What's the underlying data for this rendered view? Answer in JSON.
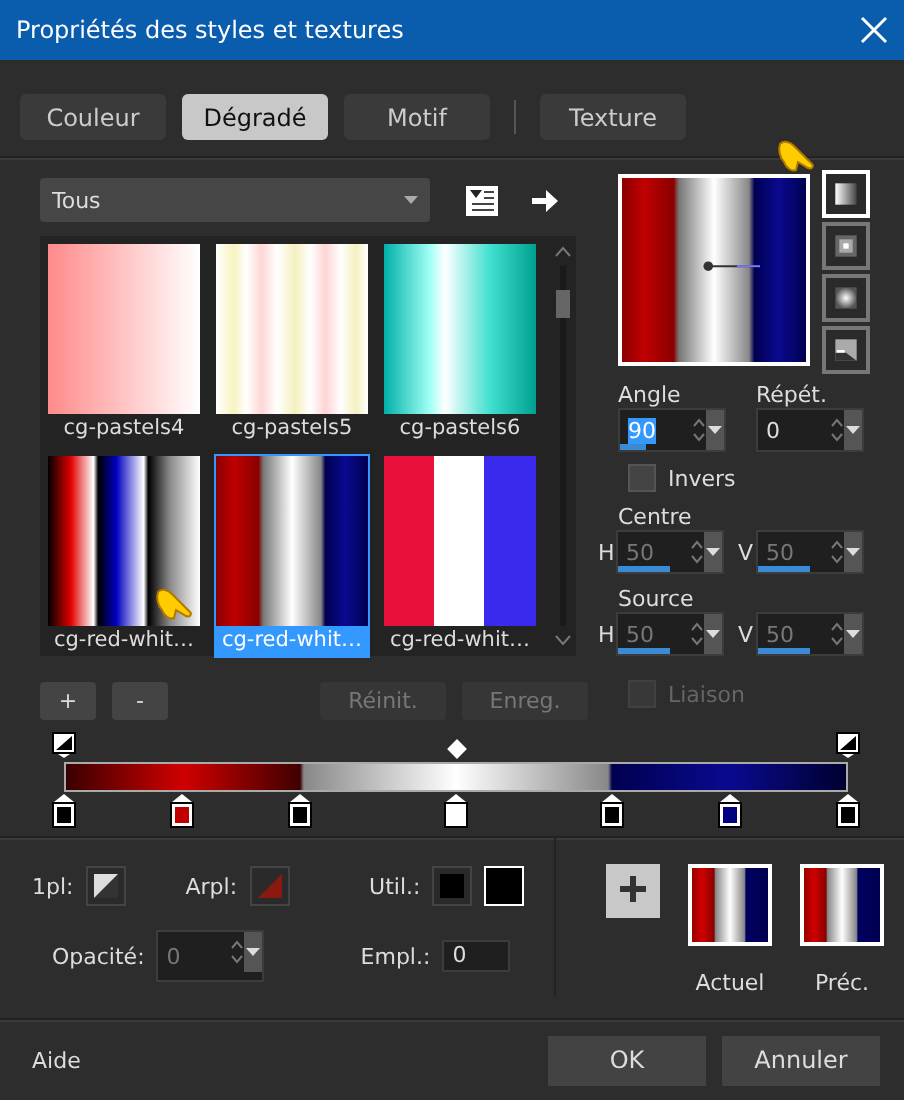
{
  "window": {
    "title": "Propriétés des styles et textures"
  },
  "tabs": [
    {
      "label": "Couleur",
      "selected": false
    },
    {
      "label": "Dégradé",
      "selected": true
    },
    {
      "label": "Motif",
      "selected": false
    },
    {
      "label": "Texture",
      "selected": false
    }
  ],
  "category": {
    "value": "Tous"
  },
  "gallery": [
    {
      "label": "cg-pastels4",
      "selected": false
    },
    {
      "label": "cg-pastels5",
      "selected": false
    },
    {
      "label": "cg-pastels6",
      "selected": false
    },
    {
      "label": "cg-red-whit…",
      "selected": false
    },
    {
      "label": "cg-red-whit…",
      "selected": true
    },
    {
      "label": "cg-red-whit…",
      "selected": false
    }
  ],
  "gallery_buttons": [
    {
      "label": "+",
      "disabled": false
    },
    {
      "label": "-",
      "disabled": false
    },
    {
      "label": "Réinit.",
      "disabled": true
    },
    {
      "label": "Enreg.",
      "disabled": true
    }
  ],
  "styles": [
    {
      "kind": "linear",
      "selected": true
    },
    {
      "kind": "rectangular",
      "selected": false
    },
    {
      "kind": "sunburst",
      "selected": false
    },
    {
      "kind": "radial",
      "selected": false
    }
  ],
  "angle": {
    "label": "Angle",
    "value": "90",
    "level": 0.25,
    "text_selected": true
  },
  "repeat": {
    "label": "Répét.",
    "value": "0",
    "text_selected": false
  },
  "invert": {
    "label": "Invers",
    "checked": false,
    "disabled": false
  },
  "center": {
    "label": "Centre",
    "h_label": "H",
    "h": {
      "value": "50",
      "level": 0.5,
      "disabled": true
    },
    "v_label": "V",
    "v": {
      "value": "50",
      "level": 0.5,
      "disabled": true
    }
  },
  "source": {
    "label": "Source",
    "h_label": "H",
    "h": {
      "value": "50",
      "level": 0.5,
      "disabled": true
    },
    "v_label": "V",
    "v": {
      "value": "50",
      "level": 0.5,
      "disabled": true
    }
  },
  "link": {
    "label": "Liaison",
    "checked": false,
    "disabled": true
  },
  "opacity_stops": [
    {
      "color": "#000000"
    },
    {
      "color": "#000000"
    }
  ],
  "color_stops": [
    {
      "color": "#000000"
    },
    {
      "color": "#c00000"
    },
    {
      "color": "#000000"
    },
    {
      "color": "#ffffff"
    },
    {
      "color": "#000000"
    },
    {
      "color": "#000080"
    },
    {
      "color": "#000000"
    }
  ],
  "stop_fields": {
    "first_label": "1pl:",
    "next_label": "Arpl:",
    "use_label": "Util.:",
    "opacity_label": "Opacité:",
    "opacity": {
      "value": "0",
      "disabled": true
    },
    "location_label": "Empl.:",
    "location": "0"
  },
  "swatches": {
    "current_label": "Actuel",
    "previous_label": "Préc."
  },
  "footer": {
    "help": "Aide",
    "ok": "OK",
    "cancel": "Annuler"
  }
}
